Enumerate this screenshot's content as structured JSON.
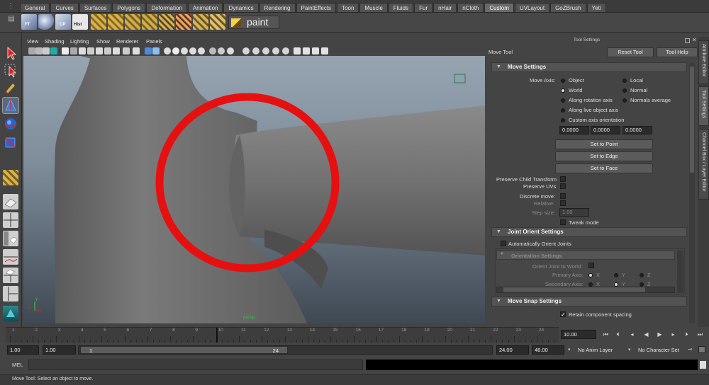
{
  "shelf_tabs": [
    "General",
    "Curves",
    "Surfaces",
    "Polygons",
    "Deformation",
    "Animation",
    "Dynamics",
    "Rendering",
    "PaintEffects",
    "Toon",
    "Muscle",
    "Fluids",
    "Fur",
    "nHair",
    "nCloth",
    "Custom",
    "UVLayout",
    "GoZBrush",
    "Yeti"
  ],
  "active_tab": "Custom",
  "shelf": {
    "ft_label": "FT",
    "cp_label": "CP",
    "hist_label": "Hist",
    "paint_label": "paint"
  },
  "viewport": {
    "menu": [
      "View",
      "Shading",
      "Lighting",
      "Show",
      "Renderer",
      "Panels"
    ],
    "camera_label": "persp",
    "axis_y": "y",
    "axis_x": "x",
    "annotation_color": "#e61010"
  },
  "tool_settings": {
    "panel_title": "Tool Settings",
    "tool_name": "Move Tool",
    "reset_button": "Reset Tool",
    "help_button": "Tool Help",
    "move_settings": {
      "header": "Move Settings",
      "move_axis_label": "Move Axis:",
      "options_left": [
        "Object",
        "World",
        "Along rotation axis",
        "Along live object axis",
        "Custom axis orientation"
      ],
      "options_right": [
        "Local",
        "Normal",
        "Normals average"
      ],
      "selected": "World",
      "vector": [
        "0.0000",
        "0.0000",
        "0.0000"
      ],
      "set_to_point": "Set to Point",
      "set_to_edge": "Set to Edge",
      "set_to_face": "Set to Face",
      "preserve_child": "Preserve Child Transform",
      "preserve_uvs": "Preserve UVs",
      "discrete_move": "Discrete move:",
      "relative": "Relative:",
      "step_size": "Step size:",
      "step_value": "1.00",
      "tweak_mode": "Tweak mode"
    },
    "joint_orient": {
      "header": "Joint Orient Settings",
      "auto_orient": "Automatically Orient Joints",
      "sub_header": "Orientation Settings",
      "orient_to_world": "Orient Joint to World:",
      "primary_axis": "Primary Axis:",
      "secondary_axis": "Secondary Axis:",
      "axes": [
        "X",
        "Y",
        "Z"
      ]
    },
    "snap": {
      "header": "Move Snap Settings",
      "retain_spacing": "Retain component spacing"
    }
  },
  "right_tabs": [
    "Attribute Editor",
    "Tool Settings",
    "Channel Box / Layer Editor"
  ],
  "timeline": {
    "ticks": [
      "1",
      "2",
      "3",
      "4",
      "5",
      "6",
      "7",
      "8",
      "9",
      "10",
      "11",
      "12",
      "13",
      "14",
      "15",
      "16",
      "17",
      "18",
      "19",
      "20",
      "21",
      "22",
      "23",
      "24"
    ],
    "current_frame": "10.00"
  },
  "range": {
    "start": "1.00",
    "playback_start": "1.00",
    "range_start_label": "1",
    "range_end_label": "24",
    "playback_end": "24.00",
    "end": "48.00",
    "anim_layer": "No Anim Layer",
    "character_set": "No Character Set"
  },
  "command_line": {
    "mel_label": "MEL"
  },
  "status_line": "Move Tool: Select an object to move."
}
